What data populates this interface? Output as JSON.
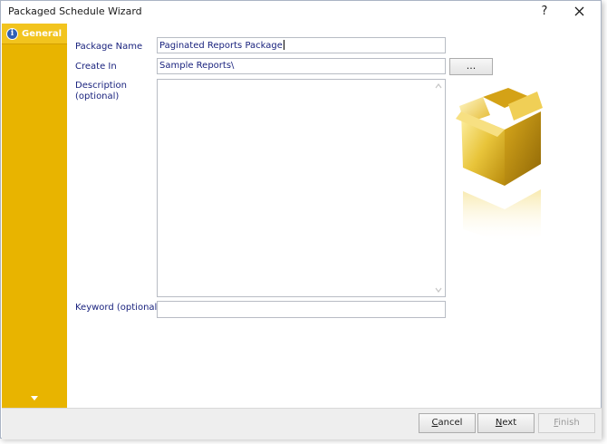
{
  "window": {
    "title": "Packaged Schedule Wizard",
    "help_label": "?"
  },
  "sidebar": {
    "items": [
      {
        "label": "General",
        "icon": "info-icon"
      }
    ],
    "colors": {
      "background": "#e8b400",
      "active": "#f2c41e"
    }
  },
  "form": {
    "package_name": {
      "label": "Package Name",
      "value": "Paginated Reports Package"
    },
    "create_in": {
      "label": "Create In",
      "value": "Sample Reports\\",
      "browse_label": "..."
    },
    "description": {
      "label_line1": "Description",
      "label_line2": "(optional)",
      "value": ""
    },
    "keyword": {
      "label": "Keyword (optional)",
      "value": ""
    }
  },
  "footer": {
    "cancel": {
      "first": "C",
      "rest": "ancel"
    },
    "next": {
      "first": "N",
      "rest": "ext"
    },
    "finish": {
      "first": "F",
      "rest": "inish"
    }
  }
}
